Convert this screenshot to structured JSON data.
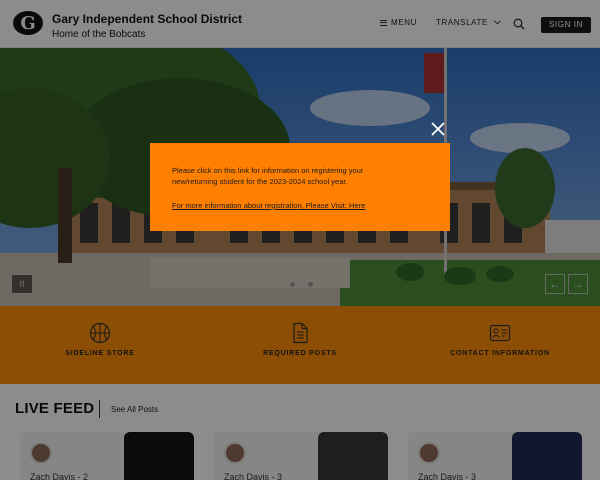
{
  "header": {
    "title": "Gary Independent School District",
    "subtitle": "Home of the Bobcats",
    "logo_letter": "G",
    "menu_label": "MENU",
    "translate_label": "TRANSLATE",
    "signin_label": "SIGN IN"
  },
  "hero": {
    "pause_label": "II",
    "prev_label": "←",
    "next_label": "→",
    "slide_count": 3,
    "active_slide": 2
  },
  "quicklinks": [
    {
      "label": "SIDELINE STORE",
      "icon": "basketball-icon"
    },
    {
      "label": "REQUIRED POSTS",
      "icon": "document-icon"
    },
    {
      "label": "CONTACT INFORMATION",
      "icon": "contact-card-icon"
    }
  ],
  "feed": {
    "title": "LIVE FEED",
    "see_all_label": "See All Posts",
    "cards": [
      {
        "author": "Zach Davis - 2"
      },
      {
        "author": "Zach Davis - 3"
      },
      {
        "author": "Zach Davis - 3"
      }
    ]
  },
  "modal": {
    "message": "Please click on this link for information on registering your new/returning student for the 2023-2024 school year.",
    "link_text": "For more information about registration, Please Visit: Here"
  },
  "colors": {
    "accent_orange": "#ff8000",
    "quicklinks_orange": "#ff8c0a",
    "signin_bg": "#1c1c1c"
  }
}
